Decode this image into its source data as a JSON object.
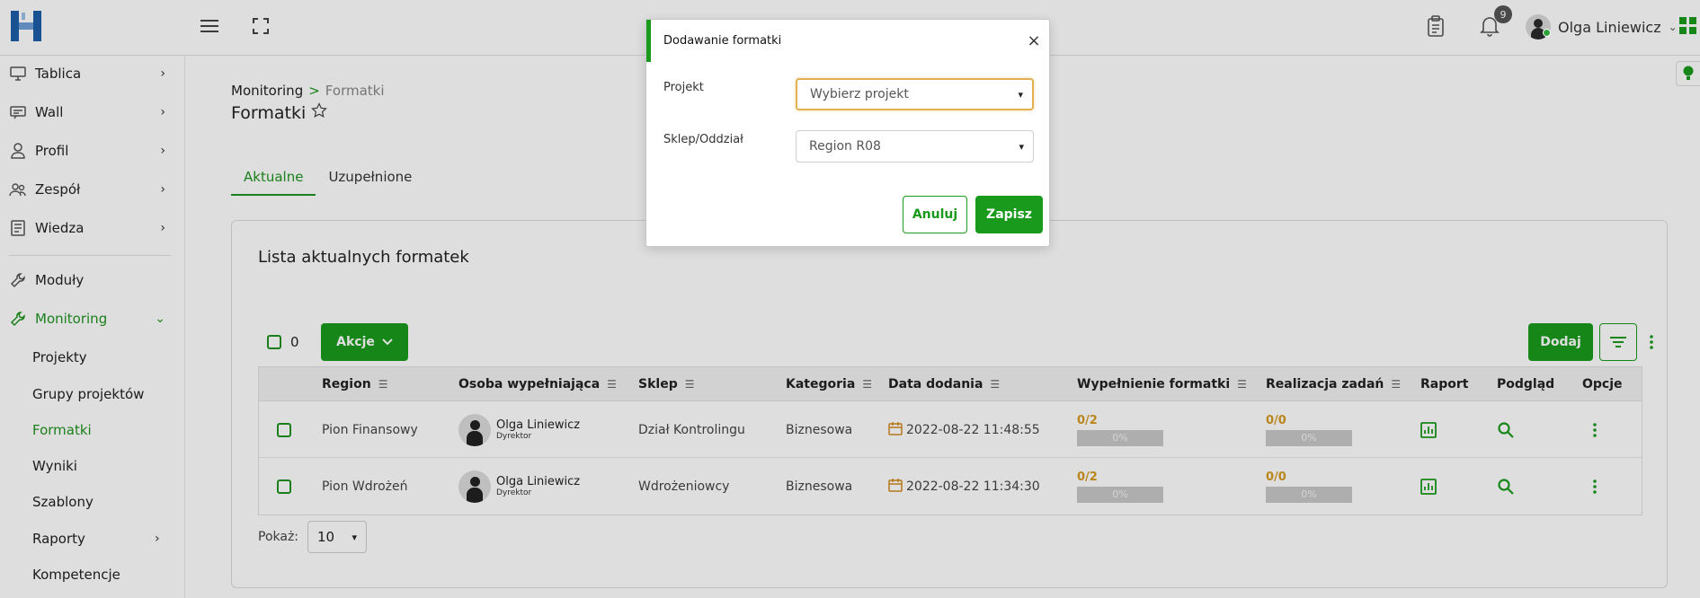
{
  "header": {
    "notifications_count": "9",
    "user_name": "Olga Liniewicz"
  },
  "sidebar": {
    "items": [
      {
        "label": "Tablica",
        "icon": "monitor-icon",
        "arrow": "›"
      },
      {
        "label": "Wall",
        "icon": "wall-icon",
        "arrow": "›"
      },
      {
        "label": "Profil",
        "icon": "user-icon",
        "arrow": "›"
      },
      {
        "label": "Zespół",
        "icon": "team-icon",
        "arrow": "›"
      },
      {
        "label": "Wiedza",
        "icon": "book-icon",
        "arrow": "›"
      },
      {
        "label": "Moduły",
        "icon": "wrench-icon"
      },
      {
        "label": "Monitoring",
        "icon": "wrench-icon",
        "arrow": "⌄"
      }
    ],
    "subitems": [
      {
        "label": "Projekty"
      },
      {
        "label": "Grupy projektów"
      },
      {
        "label": "Formatki"
      },
      {
        "label": "Wyniki"
      },
      {
        "label": "Szablony"
      },
      {
        "label": "Raporty",
        "arrow": "›"
      },
      {
        "label": "Kompetencje"
      }
    ]
  },
  "breadcrumb": {
    "parent": "Monitoring",
    "separator": ">",
    "current": "Formatki"
  },
  "page_title": "Formatki",
  "tabs": [
    {
      "label": "Aktualne"
    },
    {
      "label": "Uzupełnione"
    }
  ],
  "card": {
    "title": "Lista aktualnych formatek",
    "selected_count": "0",
    "actions_label": "Akcje",
    "add_label": "Dodaj"
  },
  "table": {
    "columns": [
      {
        "label": "Region"
      },
      {
        "label": "Osoba wypełniająca"
      },
      {
        "label": "Sklep"
      },
      {
        "label": "Kategoria"
      },
      {
        "label": "Data dodania"
      },
      {
        "label": "Wypełnienie formatki"
      },
      {
        "label": "Realizacja zadań"
      },
      {
        "label": "Raport"
      },
      {
        "label": "Podgląd"
      },
      {
        "label": "Opcje"
      }
    ],
    "rows": [
      {
        "region": "Pion Finansowy",
        "person": "Olga Liniewicz",
        "role": "Dyrektor",
        "shop": "Dział Kontrolingu",
        "category": "Biznesowa",
        "date": "2022-08-22 11:48:55",
        "fill_value": "0/2",
        "fill_percent": "0%",
        "fill_fraction": 0,
        "tasks_value": "0/0",
        "tasks_percent": "0%",
        "tasks_fraction": 0
      },
      {
        "region": "Pion Wdrożeń",
        "person": "Olga Liniewicz",
        "role": "Dyrektor",
        "shop": "Wdrożeniowcy",
        "category": "Biznesowa",
        "date": "2022-08-22 11:34:30",
        "fill_value": "0/2",
        "fill_percent": "0%",
        "fill_fraction": 0,
        "tasks_value": "0/0",
        "tasks_percent": "0%",
        "tasks_fraction": 0
      }
    ]
  },
  "pagination": {
    "label": "Pokaż:",
    "page_size": "10"
  },
  "modal": {
    "title": "Dodawanie formatki",
    "close": "×",
    "project_label": "Projekt",
    "project_placeholder": "Wybierz projekt",
    "shop_label": "Sklep/Oddział",
    "shop_value": "Region R08",
    "cancel_label": "Anuluj",
    "save_label": "Zapisz"
  },
  "colors": {
    "accent": "#1a9a1c",
    "progress_text": "#d59a1f",
    "focus_border": "#e2b04f"
  }
}
